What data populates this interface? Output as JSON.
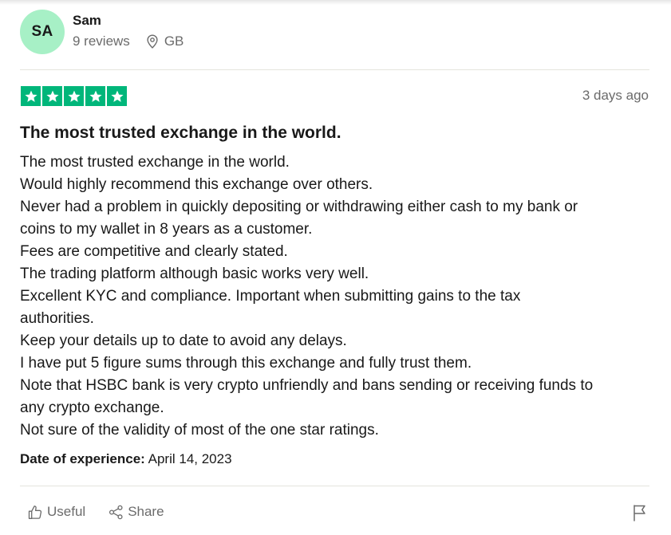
{
  "reviewer": {
    "initials": "SA",
    "name": "Sam",
    "reviews": "9 reviews",
    "country": "GB",
    "avatar_color": "#a7f0c6"
  },
  "rating": {
    "stars": 5,
    "max_stars": 5,
    "star_color": "#00b67a"
  },
  "review": {
    "date": "3 days ago",
    "title": "The most trusted exchange in the world.",
    "lines": [
      "The most trusted exchange in the world.",
      "Would highly recommend this exchange over others.",
      "Never had a problem in quickly depositing or withdrawing either cash to my bank or",
      "coins to my wallet in 8 years as a customer.",
      "Fees are competitive and clearly stated.",
      "The trading platform although basic works very well.",
      "Excellent KYC and compliance. Important when submitting gains to the tax",
      "authorities.",
      "Keep your details up to date to avoid any delays.",
      "I have put 5 figure sums through this exchange and fully trust them.",
      "Note that HSBC bank is very crypto unfriendly and bans sending or receiving funds to",
      "any crypto exchange.",
      "Not sure of the validity of most of the one star ratings."
    ],
    "experience_label": "Date of experience:",
    "experience_date": "April 14, 2023"
  },
  "actions": {
    "useful_label": "Useful",
    "share_label": "Share"
  },
  "icons": {
    "location": "location-pin-icon",
    "useful": "thumbs-up-icon",
    "share": "share-icon",
    "report": "flag-icon",
    "star": "star-icon"
  }
}
